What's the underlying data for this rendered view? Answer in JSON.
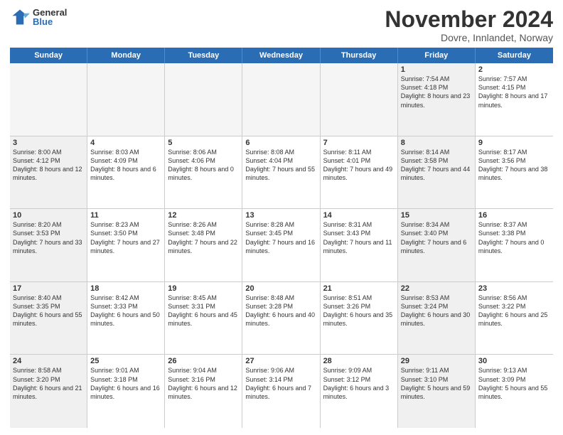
{
  "logo": {
    "general": "General",
    "blue": "Blue"
  },
  "title": "November 2024",
  "location": "Dovre, Innlandet, Norway",
  "header_days": [
    "Sunday",
    "Monday",
    "Tuesday",
    "Wednesday",
    "Thursday",
    "Friday",
    "Saturday"
  ],
  "weeks": [
    [
      {
        "day": "",
        "info": "",
        "empty": true
      },
      {
        "day": "",
        "info": "",
        "empty": true
      },
      {
        "day": "",
        "info": "",
        "empty": true
      },
      {
        "day": "",
        "info": "",
        "empty": true
      },
      {
        "day": "",
        "info": "",
        "empty": true
      },
      {
        "day": "1",
        "info": "Sunrise: 7:54 AM\nSunset: 4:18 PM\nDaylight: 8 hours\nand 23 minutes.",
        "shaded": true
      },
      {
        "day": "2",
        "info": "Sunrise: 7:57 AM\nSunset: 4:15 PM\nDaylight: 8 hours\nand 17 minutes.",
        "shaded": false
      }
    ],
    [
      {
        "day": "3",
        "info": "Sunrise: 8:00 AM\nSunset: 4:12 PM\nDaylight: 8 hours\nand 12 minutes.",
        "shaded": true
      },
      {
        "day": "4",
        "info": "Sunrise: 8:03 AM\nSunset: 4:09 PM\nDaylight: 8 hours\nand 6 minutes.",
        "shaded": false
      },
      {
        "day": "5",
        "info": "Sunrise: 8:06 AM\nSunset: 4:06 PM\nDaylight: 8 hours\nand 0 minutes.",
        "shaded": false
      },
      {
        "day": "6",
        "info": "Sunrise: 8:08 AM\nSunset: 4:04 PM\nDaylight: 7 hours\nand 55 minutes.",
        "shaded": false
      },
      {
        "day": "7",
        "info": "Sunrise: 8:11 AM\nSunset: 4:01 PM\nDaylight: 7 hours\nand 49 minutes.",
        "shaded": false
      },
      {
        "day": "8",
        "info": "Sunrise: 8:14 AM\nSunset: 3:58 PM\nDaylight: 7 hours\nand 44 minutes.",
        "shaded": true
      },
      {
        "day": "9",
        "info": "Sunrise: 8:17 AM\nSunset: 3:56 PM\nDaylight: 7 hours\nand 38 minutes.",
        "shaded": false
      }
    ],
    [
      {
        "day": "10",
        "info": "Sunrise: 8:20 AM\nSunset: 3:53 PM\nDaylight: 7 hours\nand 33 minutes.",
        "shaded": true
      },
      {
        "day": "11",
        "info": "Sunrise: 8:23 AM\nSunset: 3:50 PM\nDaylight: 7 hours\nand 27 minutes.",
        "shaded": false
      },
      {
        "day": "12",
        "info": "Sunrise: 8:26 AM\nSunset: 3:48 PM\nDaylight: 7 hours\nand 22 minutes.",
        "shaded": false
      },
      {
        "day": "13",
        "info": "Sunrise: 8:28 AM\nSunset: 3:45 PM\nDaylight: 7 hours\nand 16 minutes.",
        "shaded": false
      },
      {
        "day": "14",
        "info": "Sunrise: 8:31 AM\nSunset: 3:43 PM\nDaylight: 7 hours\nand 11 minutes.",
        "shaded": false
      },
      {
        "day": "15",
        "info": "Sunrise: 8:34 AM\nSunset: 3:40 PM\nDaylight: 7 hours\nand 6 minutes.",
        "shaded": true
      },
      {
        "day": "16",
        "info": "Sunrise: 8:37 AM\nSunset: 3:38 PM\nDaylight: 7 hours\nand 0 minutes.",
        "shaded": false
      }
    ],
    [
      {
        "day": "17",
        "info": "Sunrise: 8:40 AM\nSunset: 3:35 PM\nDaylight: 6 hours\nand 55 minutes.",
        "shaded": true
      },
      {
        "day": "18",
        "info": "Sunrise: 8:42 AM\nSunset: 3:33 PM\nDaylight: 6 hours\nand 50 minutes.",
        "shaded": false
      },
      {
        "day": "19",
        "info": "Sunrise: 8:45 AM\nSunset: 3:31 PM\nDaylight: 6 hours\nand 45 minutes.",
        "shaded": false
      },
      {
        "day": "20",
        "info": "Sunrise: 8:48 AM\nSunset: 3:28 PM\nDaylight: 6 hours\nand 40 minutes.",
        "shaded": false
      },
      {
        "day": "21",
        "info": "Sunrise: 8:51 AM\nSunset: 3:26 PM\nDaylight: 6 hours\nand 35 minutes.",
        "shaded": false
      },
      {
        "day": "22",
        "info": "Sunrise: 8:53 AM\nSunset: 3:24 PM\nDaylight: 6 hours\nand 30 minutes.",
        "shaded": true
      },
      {
        "day": "23",
        "info": "Sunrise: 8:56 AM\nSunset: 3:22 PM\nDaylight: 6 hours\nand 25 minutes.",
        "shaded": false
      }
    ],
    [
      {
        "day": "24",
        "info": "Sunrise: 8:58 AM\nSunset: 3:20 PM\nDaylight: 6 hours\nand 21 minutes.",
        "shaded": true
      },
      {
        "day": "25",
        "info": "Sunrise: 9:01 AM\nSunset: 3:18 PM\nDaylight: 6 hours\nand 16 minutes.",
        "shaded": false
      },
      {
        "day": "26",
        "info": "Sunrise: 9:04 AM\nSunset: 3:16 PM\nDaylight: 6 hours\nand 12 minutes.",
        "shaded": false
      },
      {
        "day": "27",
        "info": "Sunrise: 9:06 AM\nSunset: 3:14 PM\nDaylight: 6 hours\nand 7 minutes.",
        "shaded": false
      },
      {
        "day": "28",
        "info": "Sunrise: 9:09 AM\nSunset: 3:12 PM\nDaylight: 6 hours\nand 3 minutes.",
        "shaded": false
      },
      {
        "day": "29",
        "info": "Sunrise: 9:11 AM\nSunset: 3:10 PM\nDaylight: 5 hours\nand 59 minutes.",
        "shaded": true
      },
      {
        "day": "30",
        "info": "Sunrise: 9:13 AM\nSunset: 3:09 PM\nDaylight: 5 hours\nand 55 minutes.",
        "shaded": false
      }
    ]
  ]
}
